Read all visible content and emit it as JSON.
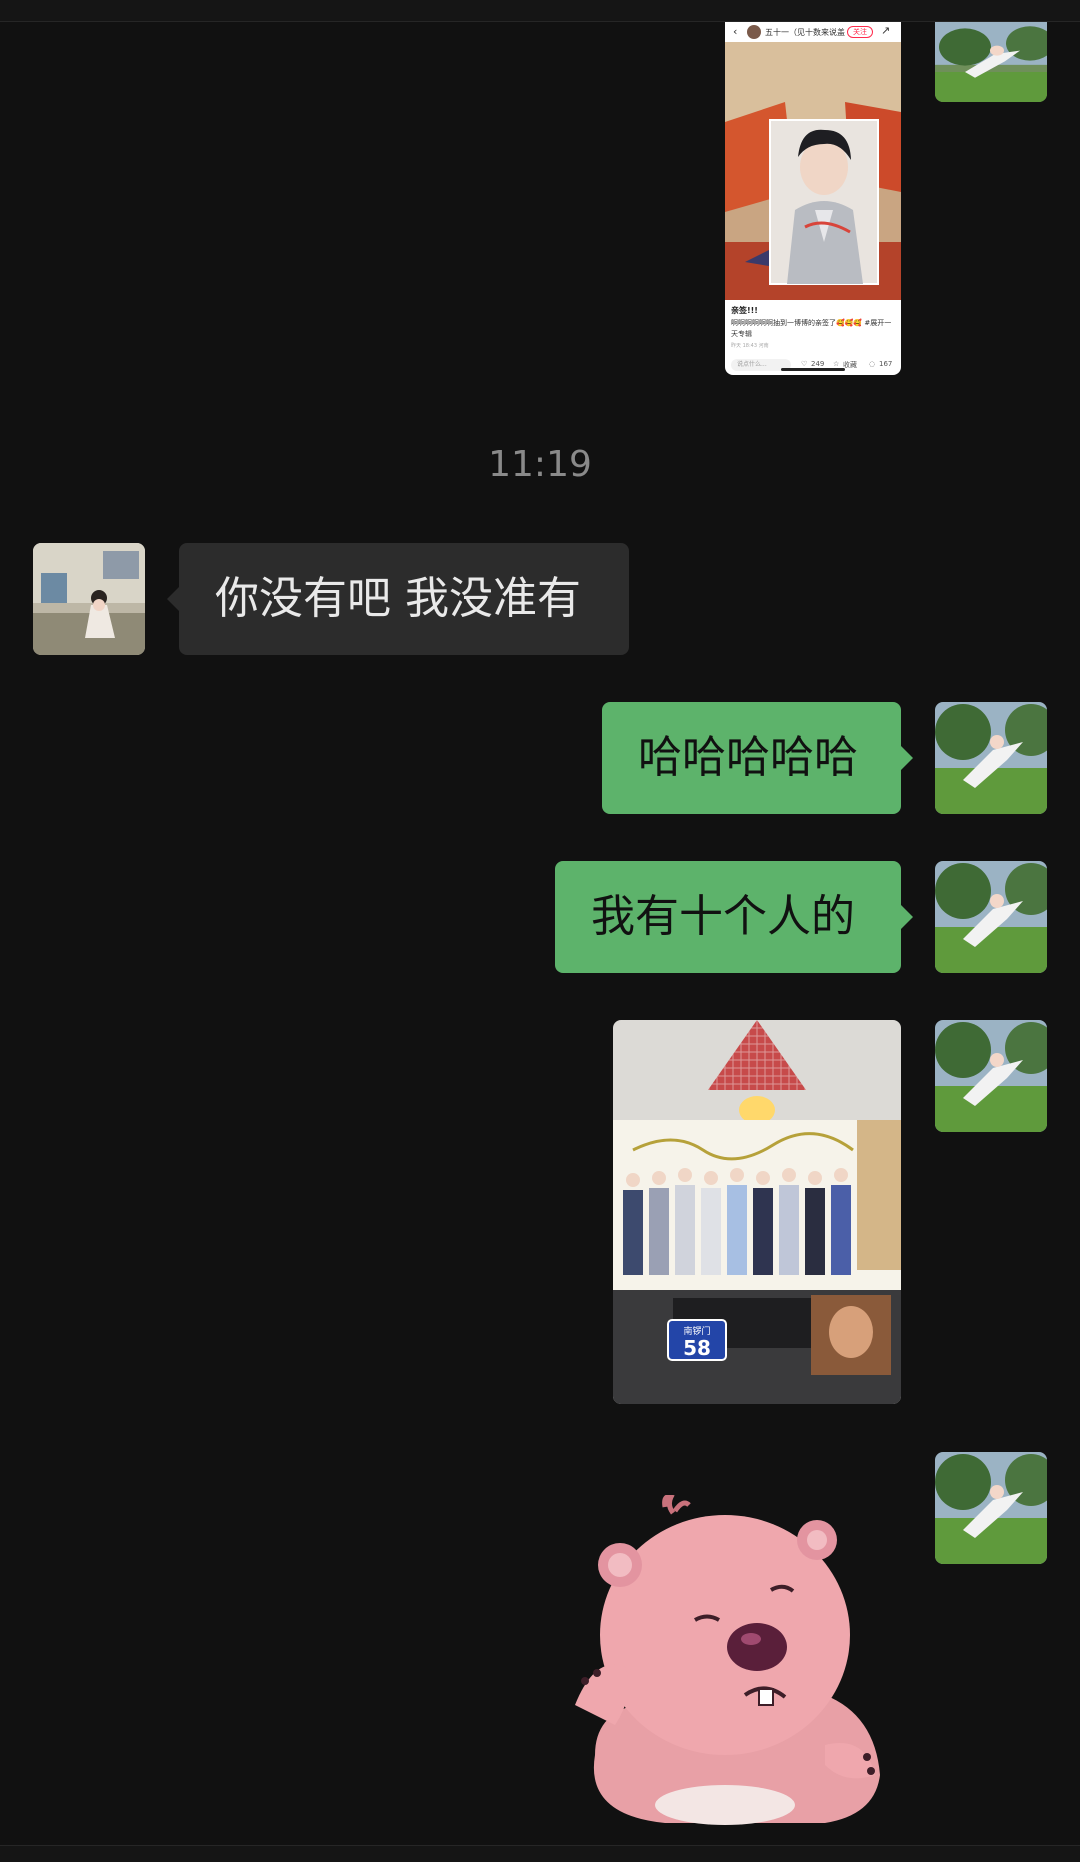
{
  "timestamp": "11:19",
  "shared_post": {
    "author": "五十一（见十数来说盖...",
    "follow_label": "关注",
    "back_icon": "chevron-left-icon",
    "share_icon": "share-icon",
    "title": "亲签!!!",
    "description": "啊啊啊啊啊啊抽到一博博的亲签了🥰🥰🥰 #展开一天专辑",
    "meta": "昨天 18:43 河南",
    "comment_placeholder": "说点什么...",
    "likes": "249",
    "favorites_label": "收藏",
    "comments": "167"
  },
  "messages": [
    {
      "side": "incoming",
      "type": "text",
      "text": "你没有吧 我没准有"
    },
    {
      "side": "outgoing",
      "type": "text",
      "text": "哈哈哈哈哈"
    },
    {
      "side": "outgoing",
      "type": "text",
      "text": "我有十个人的"
    },
    {
      "side": "outgoing",
      "type": "image",
      "photo_plate_text": "南锣门",
      "photo_plate_number": "58"
    },
    {
      "side": "outgoing",
      "type": "sticker",
      "sticker": "pink-beaver-sticker"
    }
  ],
  "colors": {
    "background": "#111111",
    "incoming_bubble": "#2c2c2c",
    "outgoing_bubble": "#5db36b",
    "timestamp": "#8a8a8a"
  }
}
